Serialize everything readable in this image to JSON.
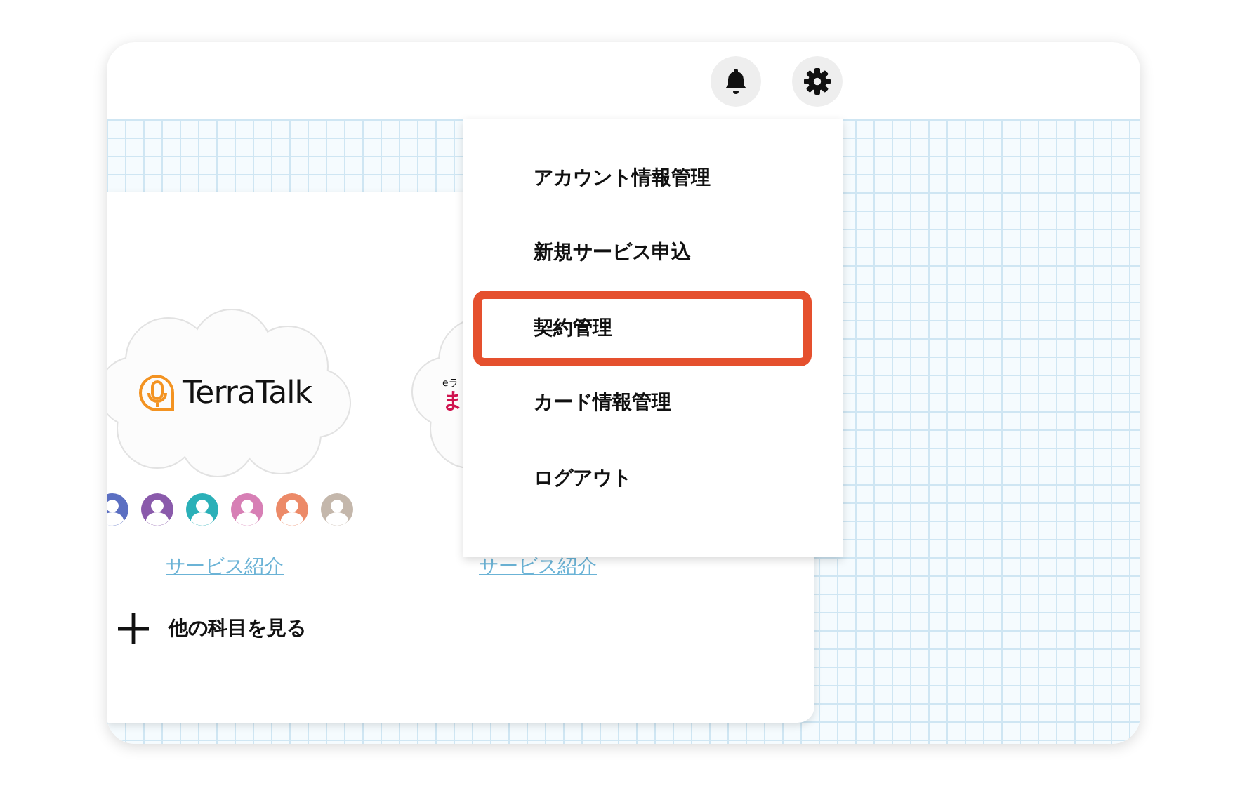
{
  "services": [
    {
      "kind": "mic",
      "logo": "TerraTalk",
      "avatars": [
        {
          "color": "#5b6fc2"
        },
        {
          "color": "#8a5aab"
        },
        {
          "color": "#2bb0b8"
        },
        {
          "color": "#d77fb5"
        },
        {
          "color": "#ec8a68"
        },
        {
          "color": "#c4b7ab"
        }
      ],
      "link": "サービス紹介"
    },
    {
      "kind": "text",
      "logo_small": "eラ",
      "logo": "ま",
      "link": "サービス紹介"
    }
  ],
  "more_link": "他の科目を見る",
  "menu": [
    {
      "label": "アカウント情報管理",
      "highlighted": false
    },
    {
      "label": "新規サービス申込",
      "highlighted": false
    },
    {
      "label": "契約管理",
      "highlighted": true
    },
    {
      "label": "カード情報管理",
      "highlighted": false
    },
    {
      "label": "ログアウト",
      "highlighted": false
    }
  ]
}
